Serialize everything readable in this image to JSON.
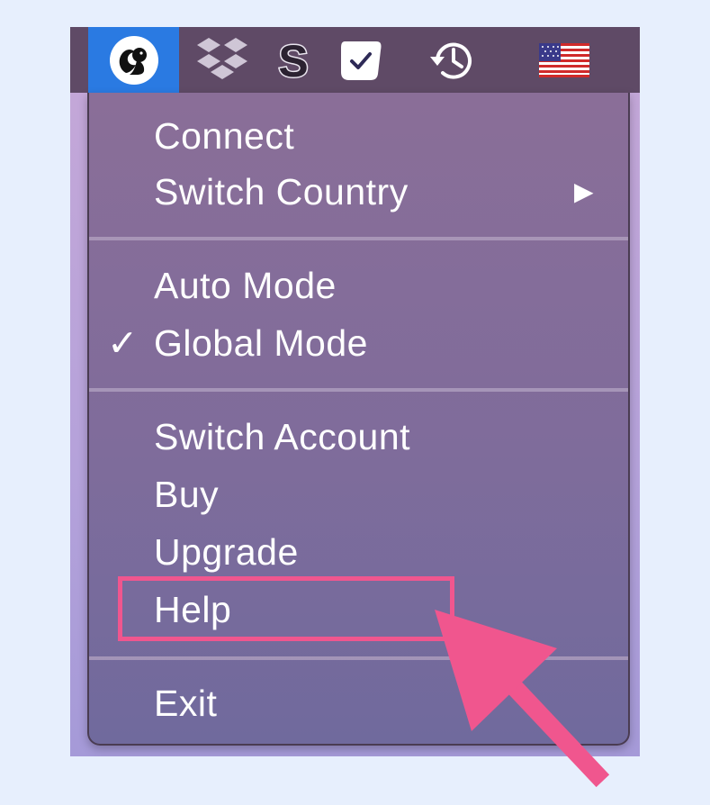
{
  "menubar": {
    "icons": [
      "vpn-squirrel-icon",
      "dropbox-icon",
      "s-app-icon",
      "checkmark-app-icon",
      "time-machine-icon",
      "us-flag-icon"
    ]
  },
  "menu": {
    "connect": "Connect",
    "switch_country": "Switch Country",
    "submenu_arrow": "▶",
    "auto_mode": "Auto Mode",
    "global_mode": "Global Mode",
    "global_mode_check": "✓",
    "switch_account": "Switch Account",
    "buy": "Buy",
    "upgrade": "Upgrade",
    "help": "Help",
    "exit": "Exit"
  },
  "colors": {
    "accent": "#2a7ae2",
    "highlight": "#f0568e",
    "menubar": "#5f4a66"
  }
}
